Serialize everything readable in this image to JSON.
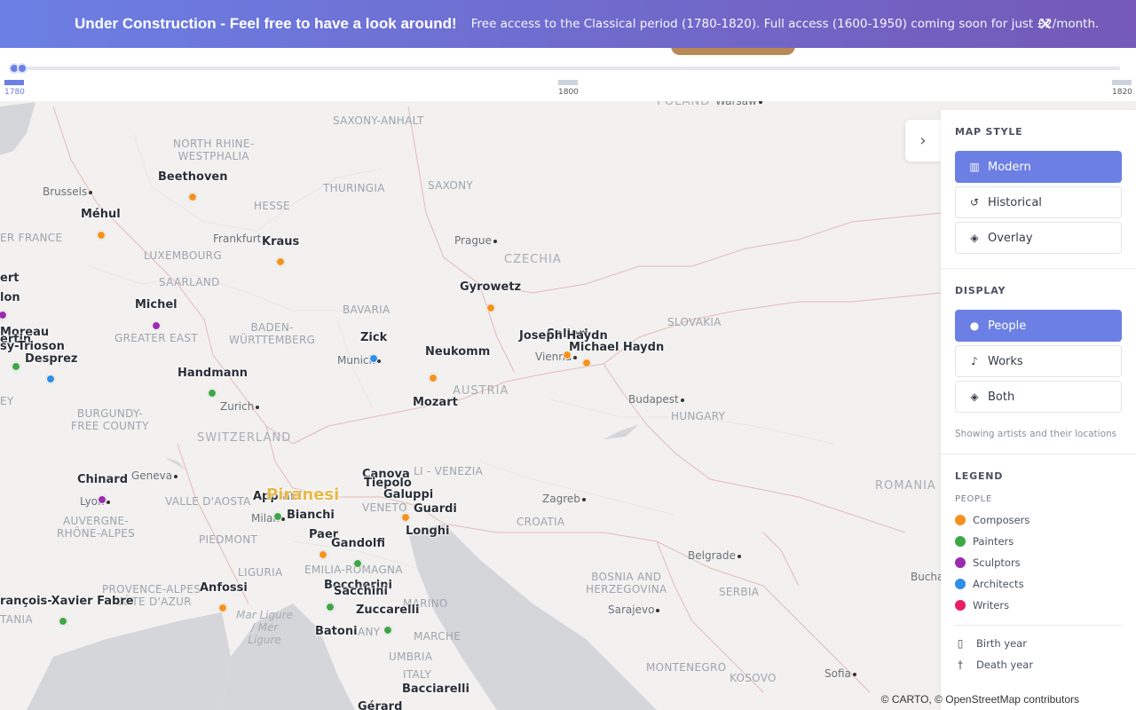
{
  "banner": {
    "title": "Under Construction - Feel free to have a look around!",
    "message": "Free access to the Classical period (1780-1820). Full access (1600-1950) coming soon for just £2/month.",
    "close": "✕"
  },
  "timeline": {
    "start_label": "1780",
    "mid_label": "1800",
    "end_label": "1820",
    "selected_start": 1780,
    "selected_end": 1780
  },
  "panel_toggle": "›",
  "sidebar": {
    "map_style": {
      "title": "MAP STYLE",
      "options": [
        {
          "label": "Modern",
          "icon": "map-icon",
          "active": true
        },
        {
          "label": "Historical",
          "icon": "history-icon",
          "active": false
        },
        {
          "label": "Overlay",
          "icon": "layers-icon",
          "active": false
        }
      ]
    },
    "display": {
      "title": "DISPLAY",
      "options": [
        {
          "label": "People",
          "icon": "person-icon",
          "active": true
        },
        {
          "label": "Works",
          "icon": "music-note-icon",
          "active": false
        },
        {
          "label": "Both",
          "icon": "layers-icon",
          "active": false
        }
      ],
      "hint": "Showing artists and their locations"
    },
    "legend": {
      "title": "LEGEND",
      "people_label": "PEOPLE",
      "categories": [
        {
          "label": "Composers",
          "color": "#f5921e"
        },
        {
          "label": "Painters",
          "color": "#3fa646"
        },
        {
          "label": "Sculptors",
          "color": "#9c2bb0"
        },
        {
          "label": "Architects",
          "color": "#2e8ee8"
        },
        {
          "label": "Writers",
          "color": "#e91e63"
        }
      ],
      "symbols": [
        {
          "symbol": "▯",
          "label": "Birth year"
        },
        {
          "symbol": "†",
          "label": "Death year"
        }
      ]
    }
  },
  "map": {
    "regions": [
      "POLAND",
      "SAXONY-ANHALT",
      "NORTH RHINE-\nWESTPHALIA",
      "THURINGIA",
      "SAXONY",
      "HESSE",
      "LUXEMBOURG",
      "SAARLAND",
      "GREATER EAST",
      "BADEN-\nWÜRTTEMBERG",
      "BAVARIA",
      "CZECHIA",
      "SLOVAKIA",
      "AUSTRIA",
      "HUNGARY",
      "BURGUNDY-\nFREE COUNTY",
      "SWITZERLAND",
      "VALLE D'AOSTA",
      "AUVERGNE-\nRHÔNE-ALPES",
      "PIEDMONT",
      "LIGURIA",
      "EMILIA-ROMAGNA",
      "PROVENCE-ALPES\n-CÔTE D'AZUR",
      "VENETO",
      "LI - VENEZIA",
      "CROATIA",
      "BOSNIA AND\nHERZEGOVINA",
      "SERBIA",
      "ROMANIA",
      "MONTENEGRO",
      "KOSOVO",
      "MARCHE",
      "UMBRIA",
      "ITALY",
      "ER FRANCE",
      "EY",
      "TANIA",
      "ANY",
      "MARINO"
    ],
    "seas": [
      "Mar Ligure\n/ Mer\nLigure"
    ],
    "cities": [
      "Warsaw",
      "Brussels",
      "Frankfurt",
      "Prague",
      "Munich",
      "Vienna",
      "Budapest",
      "Zurich",
      "Geneva",
      "Lyon",
      "Milan",
      "Zagreb",
      "Belgrade",
      "Sarajevo",
      "Sofia",
      "Bucha"
    ],
    "artists": [
      {
        "name": "Beethoven",
        "category": "composer"
      },
      {
        "name": "Méhul",
        "category": "composer"
      },
      {
        "name": "Kraus",
        "category": "composer"
      },
      {
        "name": "Gyrowetz",
        "category": "composer"
      },
      {
        "name": "Salieri",
        "category": "composer"
      },
      {
        "name": "Joseph Haydn",
        "category": "composer"
      },
      {
        "name": "Michael Haydn",
        "category": "composer"
      },
      {
        "name": "Michel",
        "category": "sculptor"
      },
      {
        "name": "Zick",
        "category": "architect"
      },
      {
        "name": "Neukomm",
        "category": "composer"
      },
      {
        "name": "Mozart",
        "category": "composer"
      },
      {
        "name": "Handmann",
        "category": "painter"
      },
      {
        "name": "ert",
        "category": "sculptor"
      },
      {
        "name": "lon",
        "category": "sculptor"
      },
      {
        "name": "Moreau",
        "category": "sculptor"
      },
      {
        "name": "ertin",
        "category": "sculptor"
      },
      {
        "name": "sy-Trioson",
        "category": "painter"
      },
      {
        "name": "Desprez",
        "category": "architect"
      },
      {
        "name": "Chinard",
        "category": "sculptor"
      },
      {
        "name": "Canova",
        "category": "sculptor"
      },
      {
        "name": "Tiepolo",
        "category": "painter"
      },
      {
        "name": "Galuppi",
        "category": "composer"
      },
      {
        "name": "Guardi",
        "category": "painter"
      },
      {
        "name": "Longhi",
        "category": "painter"
      },
      {
        "name": "Appiani",
        "category": "painter"
      },
      {
        "name": "Bianchi",
        "category": "composer"
      },
      {
        "name": "Piranesi",
        "category": "architect"
      },
      {
        "name": "Paer",
        "category": "composer"
      },
      {
        "name": "Gandolfi",
        "category": "painter"
      },
      {
        "name": "Boccherini",
        "category": "composer"
      },
      {
        "name": "Sacchini",
        "category": "composer"
      },
      {
        "name": "Anfossi",
        "category": "composer"
      },
      {
        "name": "Zuccarelli",
        "category": "painter"
      },
      {
        "name": "Batoni",
        "category": "painter"
      },
      {
        "name": "rançois-Xavier Fabre",
        "category": "painter"
      },
      {
        "name": "Bacciarelli",
        "category": "painter"
      },
      {
        "name": "Gérard",
        "category": "painter"
      }
    ]
  },
  "attribution": "© CARTO, © OpenStreetMap contributors"
}
